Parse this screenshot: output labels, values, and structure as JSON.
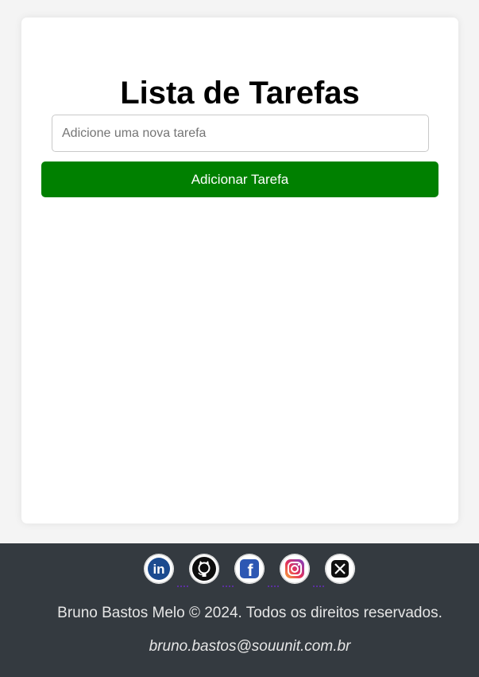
{
  "main": {
    "title": "Lista de Tarefas",
    "input_placeholder": "Adicione uma nova tarefa",
    "input_value": "",
    "add_button_label": "Adicionar Tarefa",
    "tasks": []
  },
  "footer": {
    "socials": [
      {
        "name": "linkedin-icon",
        "glyph": "in"
      },
      {
        "name": "github-icon",
        "glyph": ""
      },
      {
        "name": "facebook-icon",
        "glyph": "f"
      },
      {
        "name": "instagram-icon",
        "glyph": ""
      },
      {
        "name": "x-icon",
        "glyph": "𝕏"
      }
    ],
    "copyright": "Bruno Bastos Melo © 2024. Todos os direitos reservados.",
    "email": "bruno.bastos@souunit.com.br"
  },
  "colors": {
    "button_green": "#008000",
    "footer_bg": "#343a40",
    "page_bg": "#f4f4f4"
  }
}
